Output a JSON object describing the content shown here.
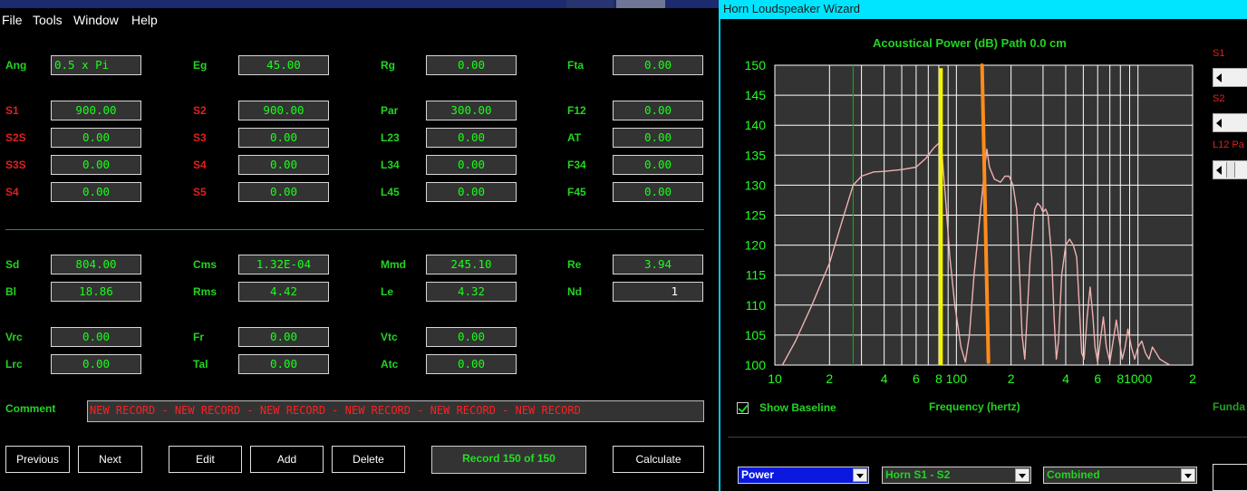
{
  "left_window": {
    "menu": [
      "File",
      "Tools",
      "Window",
      "Help"
    ],
    "fields": [
      {
        "name": "ang",
        "label": "Ang",
        "color": "g",
        "value": "0.5 x Pi"
      },
      {
        "name": "eg",
        "label": "Eg",
        "color": "g",
        "value": "45.00"
      },
      {
        "name": "rg",
        "label": "Rg",
        "color": "g",
        "value": "0.00"
      },
      {
        "name": "fta",
        "label": "Fta",
        "color": "g",
        "value": "0.00"
      },
      {
        "name": "s1",
        "label": "S1",
        "color": "r",
        "value": "900.00"
      },
      {
        "name": "s2",
        "label": "S2",
        "color": "r",
        "value": "900.00"
      },
      {
        "name": "par",
        "label": "Par",
        "color": "g",
        "value": "300.00"
      },
      {
        "name": "f12",
        "label": "F12",
        "color": "g",
        "value": "0.00"
      },
      {
        "name": "s2s",
        "label": "S2S",
        "color": "r",
        "value": "0.00"
      },
      {
        "name": "s3",
        "label": "S3",
        "color": "r",
        "value": "0.00"
      },
      {
        "name": "l23",
        "label": "L23",
        "color": "g",
        "value": "0.00"
      },
      {
        "name": "at",
        "label": "AT",
        "color": "g",
        "value": "0.00"
      },
      {
        "name": "s3s",
        "label": "S3S",
        "color": "r",
        "value": "0.00"
      },
      {
        "name": "s4a",
        "label": "S4",
        "color": "r",
        "value": "0.00"
      },
      {
        "name": "l34",
        "label": "L34",
        "color": "g",
        "value": "0.00"
      },
      {
        "name": "f34",
        "label": "F34",
        "color": "g",
        "value": "0.00"
      },
      {
        "name": "s4b",
        "label": "S4",
        "color": "r",
        "value": "0.00"
      },
      {
        "name": "s5",
        "label": "S5",
        "color": "r",
        "value": "0.00"
      },
      {
        "name": "l45",
        "label": "L45",
        "color": "g",
        "value": "0.00"
      },
      {
        "name": "f45",
        "label": "F45",
        "color": "g",
        "value": "0.00"
      },
      {
        "name": "sd",
        "label": "Sd",
        "color": "g",
        "value": "804.00"
      },
      {
        "name": "cms",
        "label": "Cms",
        "color": "g",
        "value": "1.32E-04"
      },
      {
        "name": "mmd",
        "label": "Mmd",
        "color": "g",
        "value": "245.10"
      },
      {
        "name": "re",
        "label": "Re",
        "color": "g",
        "value": "3.94"
      },
      {
        "name": "bl",
        "label": "Bl",
        "color": "g",
        "value": "18.86"
      },
      {
        "name": "rms",
        "label": "Rms",
        "color": "g",
        "value": "4.42"
      },
      {
        "name": "le",
        "label": "Le",
        "color": "g",
        "value": "4.32"
      },
      {
        "name": "nd",
        "label": "Nd",
        "color": "g",
        "value": "1"
      },
      {
        "name": "vrc",
        "label": "Vrc",
        "color": "g",
        "value": "0.00"
      },
      {
        "name": "fr",
        "label": "Fr",
        "color": "g",
        "value": "0.00"
      },
      {
        "name": "vtc",
        "label": "Vtc",
        "color": "g",
        "value": "0.00"
      },
      {
        "name": "lrc",
        "label": "Lrc",
        "color": "g",
        "value": "0.00"
      },
      {
        "name": "tal",
        "label": "Tal",
        "color": "g",
        "value": "0.00"
      },
      {
        "name": "atc",
        "label": "Atc",
        "color": "g",
        "value": "0.00"
      }
    ],
    "comment_label": "Comment",
    "comment_value": "NEW RECORD - NEW RECORD - NEW RECORD - NEW RECORD - NEW RECORD - NEW RECORD",
    "buttons": {
      "previous": "Previous",
      "next": "Next",
      "edit": "Edit",
      "add": "Add",
      "delete": "Delete",
      "calculate": "Calculate"
    },
    "record_status": "Record 150 of 150"
  },
  "right_window": {
    "title": "Horn Loudspeaker Wizard",
    "side_labels": [
      "S1",
      "S2",
      "L12 Pa"
    ],
    "show_baseline_label": "Show Baseline",
    "show_baseline_checked": true,
    "frequency_label": "Frequency (hertz)",
    "fundamental_label": "Funda",
    "selects": {
      "mode": "Power",
      "path": "Horn S1 - S2",
      "combine": "Combined"
    }
  },
  "chart_data": {
    "type": "line",
    "title": "Acoustical Power (dB)   Path 0.0 cm",
    "xlabel": "Frequency (hertz)",
    "x_scale": "log",
    "xlim": [
      10,
      2000
    ],
    "ylim": [
      100,
      150
    ],
    "y_ticks": [
      100,
      105,
      110,
      115,
      120,
      125,
      130,
      135,
      140,
      145,
      150
    ],
    "x_tick_labels": [
      {
        "value": 10,
        "label": "10"
      },
      {
        "value": 20,
        "label": "2"
      },
      {
        "value": 40,
        "label": "4"
      },
      {
        "value": 60,
        "label": "6"
      },
      {
        "value": 80,
        "label": "8"
      },
      {
        "value": 100,
        "label": "100"
      },
      {
        "value": 200,
        "label": "2"
      },
      {
        "value": 400,
        "label": "4"
      },
      {
        "value": 600,
        "label": "6"
      },
      {
        "value": 800,
        "label": "8"
      },
      {
        "value": 1000,
        "label": "1000"
      },
      {
        "value": 2000,
        "label": "2"
      }
    ],
    "grid": true,
    "colors": {
      "curve": "#f0b0b0",
      "marker_yellow": "#f5f500",
      "marker_orange": "#ff8c1a",
      "baseline_green": "#1aa01a",
      "plot_bg": "#333333",
      "grid": "#ffffff",
      "tick_text": "#22ff22"
    },
    "vertical_markers": [
      {
        "name": "green-line",
        "x": 27,
        "y_from": 100,
        "y_to": 150
      },
      {
        "name": "yellow-marker",
        "x": 82,
        "y_from": 100,
        "y_to": 149.5
      },
      {
        "name": "orange-marker",
        "x": 145,
        "y_from": 100.5,
        "y_to": 150
      }
    ],
    "series": [
      {
        "points": [
          [
            11,
            100
          ],
          [
            13,
            104
          ],
          [
            16,
            110
          ],
          [
            20,
            117
          ],
          [
            24,
            125
          ],
          [
            27,
            130
          ],
          [
            30,
            131.5
          ],
          [
            35,
            132.2
          ],
          [
            40,
            132.3
          ],
          [
            50,
            132.6
          ],
          [
            60,
            133
          ],
          [
            68,
            134.5
          ],
          [
            75,
            136.2
          ],
          [
            80,
            137
          ],
          [
            83,
            136
          ],
          [
            87,
            128
          ],
          [
            92,
            118
          ],
          [
            98,
            110
          ],
          [
            106,
            103
          ],
          [
            112,
            100.5
          ],
          [
            118,
            105
          ],
          [
            125,
            115
          ],
          [
            135,
            125
          ],
          [
            142,
            132
          ],
          [
            147,
            136
          ],
          [
            152,
            133
          ],
          [
            162,
            131
          ],
          [
            175,
            130.5
          ],
          [
            185,
            131.5
          ],
          [
            195,
            131.5
          ],
          [
            205,
            130
          ],
          [
            215,
            126
          ],
          [
            223,
            115
          ],
          [
            230,
            105
          ],
          [
            238,
            101
          ],
          [
            245,
            108
          ],
          [
            255,
            118
          ],
          [
            270,
            126
          ],
          [
            280,
            127
          ],
          [
            290,
            126.5
          ],
          [
            300,
            125.5
          ],
          [
            310,
            126
          ],
          [
            320,
            125
          ],
          [
            335,
            118
          ],
          [
            345,
            108
          ],
          [
            355,
            101
          ],
          [
            365,
            104
          ],
          [
            380,
            115
          ],
          [
            400,
            120
          ],
          [
            420,
            121
          ],
          [
            440,
            120
          ],
          [
            460,
            118
          ],
          [
            475,
            110
          ],
          [
            490,
            102
          ],
          [
            505,
            101
          ],
          [
            525,
            108
          ],
          [
            545,
            113
          ],
          [
            565,
            108
          ],
          [
            580,
            103
          ],
          [
            600,
            100.5
          ],
          [
            620,
            104
          ],
          [
            645,
            108
          ],
          [
            670,
            103
          ],
          [
            700,
            100.5
          ],
          [
            730,
            104
          ],
          [
            760,
            107.5
          ],
          [
            790,
            104
          ],
          [
            820,
            101
          ],
          [
            850,
            103
          ],
          [
            880,
            106
          ],
          [
            920,
            103
          ],
          [
            960,
            101
          ],
          [
            1000,
            103
          ],
          [
            1050,
            104
          ],
          [
            1100,
            102
          ],
          [
            1150,
            101
          ],
          [
            1200,
            103
          ],
          [
            1260,
            102
          ],
          [
            1320,
            101
          ],
          [
            1400,
            100.5
          ],
          [
            1500,
            100
          ]
        ]
      }
    ]
  }
}
